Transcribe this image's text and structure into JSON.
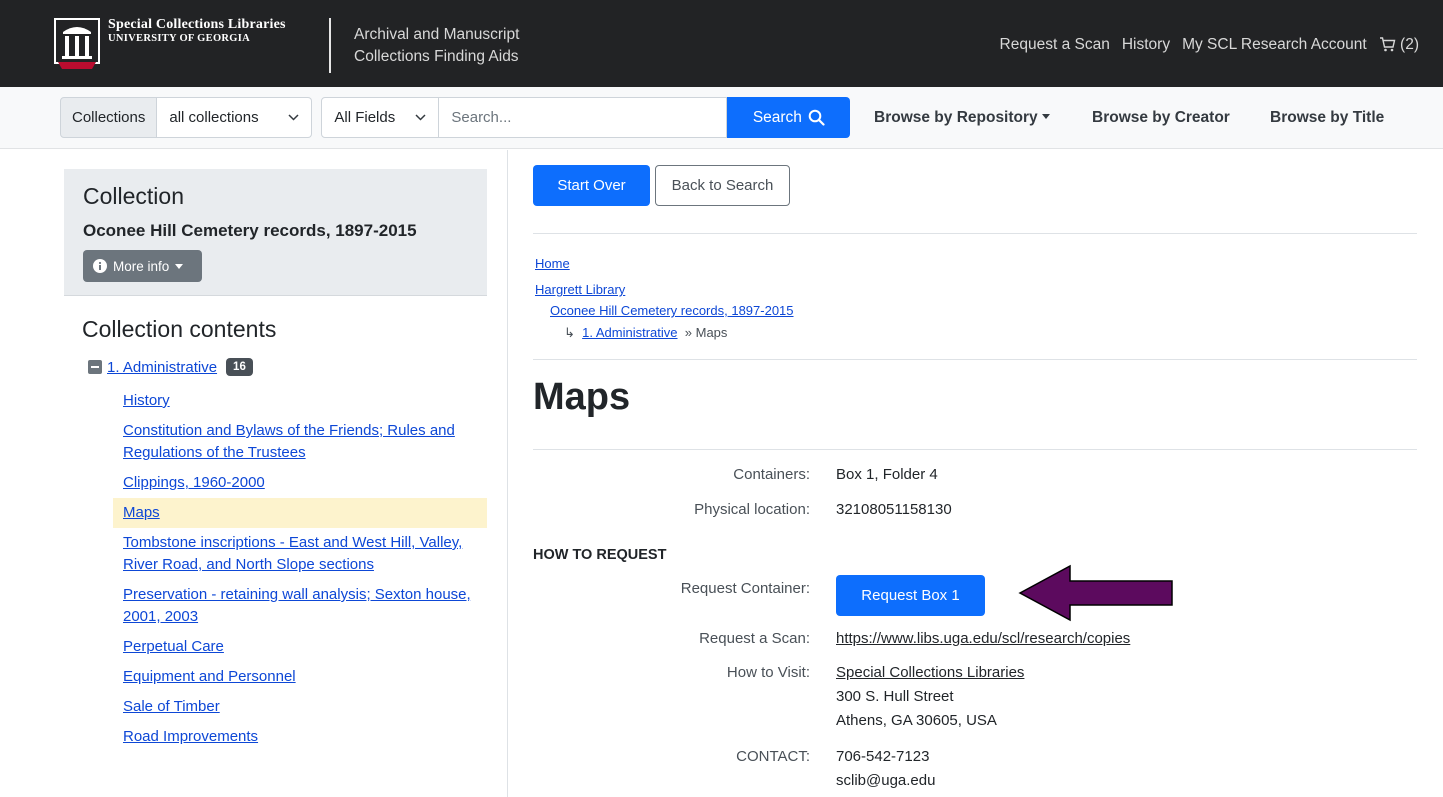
{
  "header": {
    "logo_line1": "Special Collections Libraries",
    "logo_line2": "UNIVERSITY OF GEORGIA",
    "site_line1": "Archival and Manuscript",
    "site_line2": "Collections Finding Aids",
    "nav": [
      "Request a Scan",
      "History",
      "My SCL Research Account"
    ],
    "cart_count": "(2)"
  },
  "search": {
    "scope_label": "Collections",
    "scope_value": "all collections",
    "field_value": "All Fields",
    "placeholder": "Search...",
    "button_label": "Search",
    "browse_repository": "Browse by Repository",
    "browse_creator": "Browse by Creator",
    "browse_title": "Browse by Title"
  },
  "sidebar": {
    "heading": "Collection",
    "collection_title": "Oconee Hill Cemetery records, 1897-2015",
    "more_info": "More info",
    "contents_heading": "Collection contents",
    "root": {
      "label": "1. Administrative",
      "count": "16"
    },
    "items": [
      "History",
      "Constitution and Bylaws of the Friends; Rules and Regulations of the Trustees",
      "Clippings, 1960-2000",
      "Maps",
      "Tombstone inscriptions - East and West Hill, Valley, River Road, and North Slope sections",
      "Preservation - retaining wall analysis; Sexton house, 2001, 2003",
      "Perpetual Care",
      "Equipment and Personnel",
      "Sale of Timber",
      "Road Improvements"
    ],
    "active_index": 3
  },
  "main": {
    "start_over": "Start Over",
    "back_to_search": "Back to Search",
    "breadcrumb": {
      "home": "Home",
      "library": "Hargrett Library",
      "collection": "Oconee Hill Cemetery records, 1897-2015",
      "arrow": "↳",
      "series": "1. Administrative",
      "sep": "»",
      "current": "Maps"
    },
    "title": "Maps",
    "containers_label": "Containers:",
    "containers_value": "Box 1, Folder 4",
    "location_label": "Physical location:",
    "location_value": "32108051158130",
    "how_to_request": "HOW TO REQUEST",
    "request_container_label": "Request Container:",
    "request_button": "Request Box 1",
    "request_scan_label": "Request a Scan:",
    "request_scan_url": "https://www.libs.uga.edu/scl/research/copies",
    "visit_label": "How to Visit:",
    "visit_name": "Special Collections Libraries",
    "visit_address1": "300 S. Hull Street",
    "visit_address2": "Athens, GA 30605, USA",
    "contact_label": "CONTACT:",
    "contact_phone": "706-542-7123",
    "contact_email": "sclib@uga.edu"
  },
  "colors": {
    "header_bg": "#222325",
    "primary": "#0d6efd",
    "active_item": "#fdf3cd",
    "annotation_arrow": "#5c0a5e"
  }
}
